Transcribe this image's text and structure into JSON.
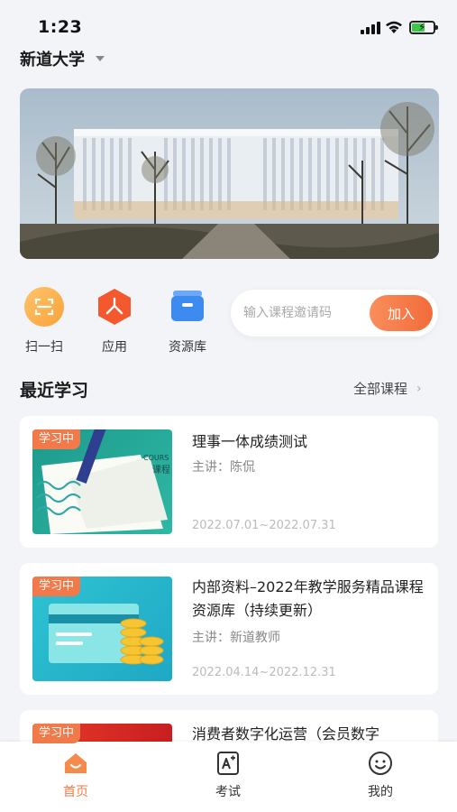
{
  "status": {
    "time": "1:23"
  },
  "header": {
    "school_name": "新道大学"
  },
  "quick_actions": [
    {
      "label": "扫一扫",
      "icon": "scan-icon"
    },
    {
      "label": "应用",
      "icon": "apps-icon"
    },
    {
      "label": "资源库",
      "icon": "resource-library-icon"
    }
  ],
  "invite": {
    "placeholder": "输入课程邀请码",
    "join_label": "加入"
  },
  "recent": {
    "title": "最近学习",
    "all_label": "全部课程"
  },
  "courses": [
    {
      "badge": "学习中",
      "title": "理事一体成绩测试",
      "teacher": "主讲：陈侃",
      "date": "2022.07.01~2022.07.31",
      "thumb_text": "COURS\n课程"
    },
    {
      "badge": "学习中",
      "title": "内部资料–2022年教学服务精品课程资源库（持续更新）",
      "teacher": "主讲：新道教师",
      "date": "2022.04.14~2022.12.31"
    },
    {
      "badge": "学习中",
      "title": "消费者数字化运营（会员数字"
    }
  ],
  "tabs": [
    {
      "label": "首页",
      "icon": "home-icon",
      "active": true
    },
    {
      "label": "考试",
      "icon": "exam-icon",
      "active": false
    },
    {
      "label": "我的",
      "icon": "profile-icon",
      "active": false
    }
  ],
  "colors": {
    "accent": "#f27a4a",
    "background": "#f3f4f8"
  }
}
